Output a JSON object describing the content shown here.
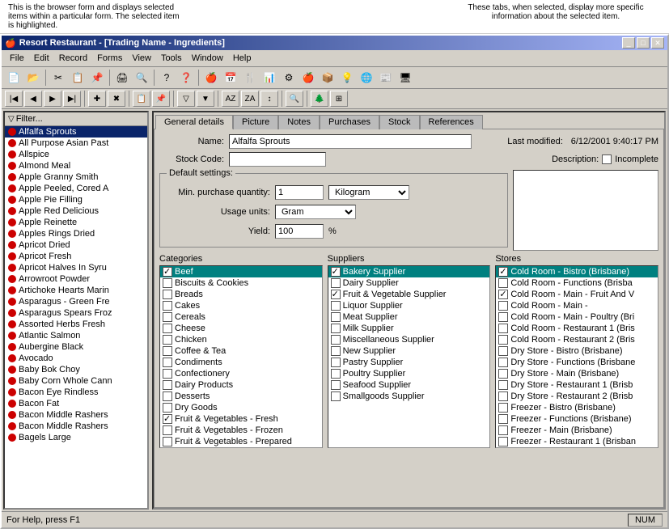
{
  "annotations": {
    "left": "This is the browser form and displays selected items within a particular form. The selected item is highlighted.",
    "right": "These tabs, when selected, display more specific information about the selected item."
  },
  "window": {
    "title": "Resort Restaurant - [Trading Name - Ingredients]",
    "min": "_",
    "max": "□",
    "close": "✕"
  },
  "menu": {
    "items": [
      "File",
      "Edit",
      "Record",
      "Forms",
      "View",
      "Tools",
      "Window",
      "Help"
    ]
  },
  "nav": {
    "filter_label": "Filter..."
  },
  "ingredients": [
    {
      "name": "Alfalfa Sprouts",
      "selected": true
    },
    {
      "name": "All Purpose Asian Past"
    },
    {
      "name": "Allspice"
    },
    {
      "name": "Almond Meal"
    },
    {
      "name": "Apple Granny Smith"
    },
    {
      "name": "Apple Peeled, Cored A"
    },
    {
      "name": "Apple Pie Filling"
    },
    {
      "name": "Apple Red Delicious"
    },
    {
      "name": "Apple Reinette"
    },
    {
      "name": "Apples Rings Dried"
    },
    {
      "name": "Apricot Dried"
    },
    {
      "name": "Apricot Fresh"
    },
    {
      "name": "Apricot Halves In Syru"
    },
    {
      "name": "Arrowroot Powder"
    },
    {
      "name": "Artichoke Hearts Marin"
    },
    {
      "name": "Asparagus - Green Fre"
    },
    {
      "name": "Asparagus Spears Froz"
    },
    {
      "name": "Assorted Herbs Fresh"
    },
    {
      "name": "Atlantic Salmon"
    },
    {
      "name": "Aubergine Black"
    },
    {
      "name": "Avocado"
    },
    {
      "name": "Baby Bok Choy"
    },
    {
      "name": "Baby Corn Whole Cann"
    },
    {
      "name": "Bacon Eye Rindless"
    },
    {
      "name": "Bacon Fat"
    },
    {
      "name": "Bacon Middle Rashers"
    },
    {
      "name": "Bacon Middle Rashers"
    },
    {
      "name": "Bagels Large"
    }
  ],
  "detail": {
    "name_label": "Name:",
    "name_value": "Alfalfa Sprouts",
    "stock_code_label": "Stock Code:",
    "stock_code_value": "",
    "last_modified_label": "Last modified:",
    "last_modified_value": "6/12/2001 9:40:17 PM",
    "incomplete_label": "Incomplete",
    "description_label": "Description:",
    "default_settings_label": "Default settings:",
    "min_purchase_label": "Min. purchase quantity:",
    "min_purchase_value": "1",
    "min_purchase_unit": "Kilogram",
    "usage_units_label": "Usage units:",
    "usage_units_value": "Gram",
    "yield_label": "Yield:",
    "yield_value": "100",
    "yield_symbol": "%"
  },
  "tabs": [
    "General details",
    "Picture",
    "Notes",
    "Purchases",
    "Stock",
    "References"
  ],
  "active_tab": "General details",
  "categories": {
    "title": "Categories",
    "items": [
      {
        "label": "Beef",
        "checked": true,
        "highlighted": true
      },
      {
        "label": "Biscuits & Cookies",
        "checked": false
      },
      {
        "label": "Breads",
        "checked": false
      },
      {
        "label": "Cakes",
        "checked": false
      },
      {
        "label": "Cereals",
        "checked": false
      },
      {
        "label": "Cheese",
        "checked": false
      },
      {
        "label": "Chicken",
        "checked": false
      },
      {
        "label": "Coffee & Tea",
        "checked": false
      },
      {
        "label": "Condiments",
        "checked": false
      },
      {
        "label": "Confectionery",
        "checked": false
      },
      {
        "label": "Dairy Products",
        "checked": false
      },
      {
        "label": "Desserts",
        "checked": false
      },
      {
        "label": "Dry Goods",
        "checked": false
      },
      {
        "label": "Fruit & Vegetables - Fresh",
        "checked": true
      },
      {
        "label": "Fruit & Vegetables - Frozen",
        "checked": false
      },
      {
        "label": "Fruit & Vegetables - Prepared",
        "checked": false
      }
    ]
  },
  "suppliers": {
    "title": "Suppliers",
    "items": [
      {
        "label": "Bakery Supplier",
        "checked": true,
        "highlighted": true
      },
      {
        "label": "Dairy Supplier",
        "checked": false
      },
      {
        "label": "Fruit & Vegetable Supplier",
        "checked": true
      },
      {
        "label": "Liquor Supplier",
        "checked": false
      },
      {
        "label": "Meat Supplier",
        "checked": false
      },
      {
        "label": "Milk Supplier",
        "checked": false
      },
      {
        "label": "Miscellaneous Supplier",
        "checked": false
      },
      {
        "label": "New Supplier",
        "checked": false
      },
      {
        "label": "Pastry Supplier",
        "checked": false
      },
      {
        "label": "Poultry Supplier",
        "checked": false
      },
      {
        "label": "Seafood Supplier",
        "checked": false
      },
      {
        "label": "Smallgoods Supplier",
        "checked": false
      }
    ]
  },
  "stores": {
    "title": "Stores",
    "items": [
      {
        "label": "Cold Room - Bistro (Brisbane)",
        "checked": true,
        "highlighted": true
      },
      {
        "label": "Cold Room - Functions (Brisba",
        "checked": false
      },
      {
        "label": "Cold Room - Main - Fruit And V",
        "checked": true
      },
      {
        "label": "Cold Room - Main -",
        "checked": false
      },
      {
        "label": "Cold Room - Main - Poultry (Bri",
        "checked": false
      },
      {
        "label": "Cold Room - Restaurant 1 (Bris",
        "checked": false
      },
      {
        "label": "Cold Room - Restaurant 2 (Bris",
        "checked": false
      },
      {
        "label": "Dry Store - Bistro (Brisbane)",
        "checked": false
      },
      {
        "label": "Dry Store - Functions (Brisbane",
        "checked": false
      },
      {
        "label": "Dry Store - Main (Brisbane)",
        "checked": false
      },
      {
        "label": "Dry Store - Restaurant 1 (Brisb",
        "checked": false
      },
      {
        "label": "Dry Store - Restaurant 2 (Brisb",
        "checked": false
      },
      {
        "label": "Freezer - Bistro (Brisbane)",
        "checked": false
      },
      {
        "label": "Freezer - Functions (Brisbane)",
        "checked": false
      },
      {
        "label": "Freezer - Main (Brisbane)",
        "checked": false
      },
      {
        "label": "Freezer - Restaurant 1 (Brisban",
        "checked": false
      }
    ]
  },
  "status_bar": {
    "help_text": "For Help, press F1",
    "num_lock": "NUM"
  }
}
